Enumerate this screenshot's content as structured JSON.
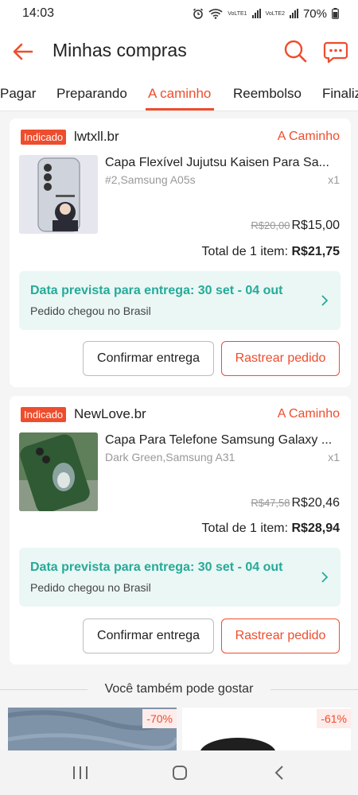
{
  "status_bar": {
    "time": "14:03",
    "lte1": "VoLTE1",
    "lte2": "VoLTE2",
    "battery": "70%"
  },
  "header": {
    "title": "Minhas compras"
  },
  "tabs": [
    {
      "label": "Pagar",
      "active": false
    },
    {
      "label": "Preparando",
      "active": false
    },
    {
      "label": "A caminho",
      "active": true
    },
    {
      "label": "Reembolso",
      "active": false
    },
    {
      "label": "Finaliz",
      "active": false
    }
  ],
  "orders": [
    {
      "badge": "Indicado",
      "shop": "lwtxll.br",
      "status": "A Caminho",
      "product_name": "Capa Flexível Jujutsu Kaisen Para Sa...",
      "variant": "#2,Samsung A05s",
      "quantity": "x1",
      "old_price": "R$20,00",
      "price": "R$15,00",
      "total_label": "Total de 1 item:",
      "total_value": "R$21,75",
      "delivery_title": "Data prevista para entrega: 30 set - 04 out",
      "delivery_sub": "Pedido chegou no Brasil",
      "confirm_label": "Confirmar entrega",
      "track_label": "Rastrear pedido"
    },
    {
      "badge": "Indicado",
      "shop": "NewLove.br",
      "status": "A Caminho",
      "product_name": "Capa Para Telefone Samsung Galaxy ...",
      "variant": "Dark Green,Samsung A31",
      "quantity": "x1",
      "old_price": "R$47,58",
      "price": "R$20,46",
      "total_label": "Total de 1 item:",
      "total_value": "R$28,94",
      "delivery_title": "Data prevista para entrega: 30 set - 04 out",
      "delivery_sub": "Pedido chegou no Brasil",
      "confirm_label": "Confirmar entrega",
      "track_label": "Rastrear pedido"
    }
  ],
  "recommendations": {
    "title": "Você também pode gostar",
    "items": [
      {
        "discount": "-70%"
      },
      {
        "discount": "-61%"
      }
    ]
  },
  "colors": {
    "accent": "#ee4d2d",
    "delivery_green": "#26aa99",
    "delivery_bg": "#eaf7f4"
  }
}
